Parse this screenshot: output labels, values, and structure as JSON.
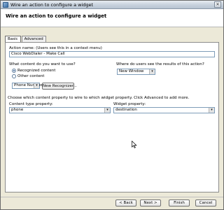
{
  "window": {
    "title": "Wire an action to configure a widget",
    "close_glyph": "✕"
  },
  "header": {
    "title": "Wire an action to configure a widget"
  },
  "tabs": [
    {
      "label": "Basic",
      "active": true
    },
    {
      "label": "Advanced",
      "active": false
    }
  ],
  "action_name": {
    "label": "Action name: (Users see this in a context menu)",
    "value": "Cisco WebDialer - Make Call"
  },
  "content": {
    "label": "What content do you want to use?",
    "options": [
      {
        "label": "Recognized content",
        "checked": true
      },
      {
        "label": "Other content",
        "checked": false
      }
    ],
    "recognizer_select": "Phone Number",
    "new_recognizer_button": "New Recognizer..."
  },
  "results": {
    "label": "Where do users see the results of this action?",
    "select": "New Window"
  },
  "wire_instruction": "Choose which content property to wire to which widget property. Click Advanced to add more.",
  "content_type": {
    "label": "Content type property:",
    "value": "phone"
  },
  "widget_property": {
    "label": "Widget property:",
    "value": "destination"
  },
  "footer": {
    "back": "< Back",
    "next": "Next >",
    "finish": "Finish",
    "cancel": "Cancel"
  }
}
